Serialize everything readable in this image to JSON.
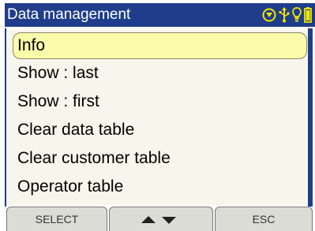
{
  "title": "Data management",
  "status_icons": [
    "target-icon",
    "usb-icon",
    "bulb-icon",
    "battery-icon"
  ],
  "menu": {
    "items": [
      {
        "label": "Info",
        "selected": true
      },
      {
        "label": "Show : last",
        "selected": false
      },
      {
        "label": "Show : first",
        "selected": false
      },
      {
        "label": "Clear data table",
        "selected": false
      },
      {
        "label": "Clear customer table",
        "selected": false
      },
      {
        "label": "Operator table",
        "selected": false
      }
    ]
  },
  "softkeys": {
    "left_label": "SELECT",
    "middle_icons": [
      "up-arrow-icon",
      "down-arrow-icon"
    ],
    "right_label": "ESC"
  },
  "colors": {
    "titlebar": "#1f3d8a",
    "menu_bg": "#f6f6ec",
    "selection_bg": "#fafaaa",
    "softkey_bg": "#dcdcd6",
    "status_icon_yellow": "#f2e600"
  }
}
